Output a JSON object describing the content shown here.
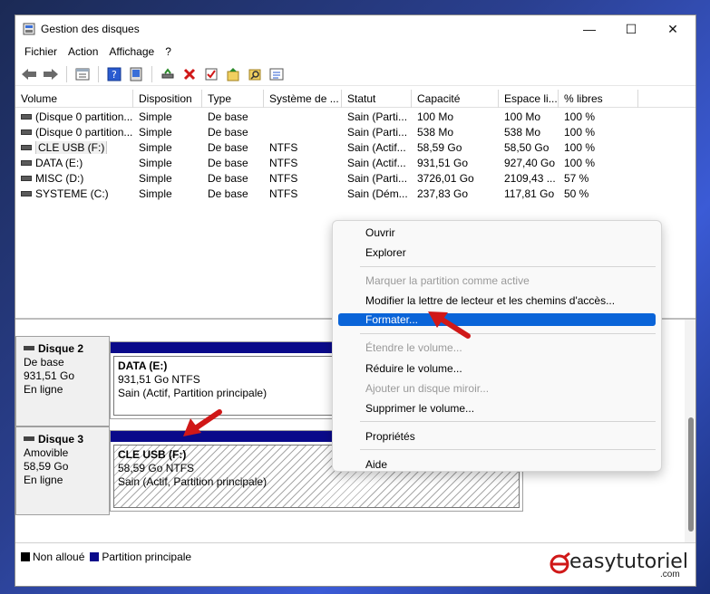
{
  "window": {
    "title": "Gestion des disques",
    "controls": {
      "minimize": "—",
      "maximize": "☐",
      "close": "✕"
    }
  },
  "menu": [
    "Fichier",
    "Action",
    "Affichage",
    "?"
  ],
  "toolbar": {
    "icons": [
      "back-icon",
      "forward-icon",
      "properties-icon",
      "help-icon",
      "help-book-icon",
      "connect-icon",
      "delete-icon",
      "check-icon",
      "new-icon",
      "search-icon",
      "list-icon"
    ]
  },
  "volume_list": {
    "columns": [
      "Volume",
      "Disposition",
      "Type",
      "Système de ...",
      "Statut",
      "Capacité",
      "Espace li...",
      "% libres"
    ],
    "rows": [
      [
        "(Disque 0 partition...",
        "Simple",
        "De base",
        "",
        "Sain (Parti...",
        "100 Mo",
        "100 Mo",
        "100 %"
      ],
      [
        "(Disque 0 partition...",
        "Simple",
        "De base",
        "",
        "Sain (Parti...",
        "538 Mo",
        "538 Mo",
        "100 %"
      ],
      [
        "CLE USB (F:)",
        "Simple",
        "De base",
        "NTFS",
        "Sain (Actif...",
        "58,59 Go",
        "58,50 Go",
        "100 %"
      ],
      [
        "DATA (E:)",
        "Simple",
        "De base",
        "NTFS",
        "Sain (Actif...",
        "931,51 Go",
        "927,40 Go",
        "100 %"
      ],
      [
        "MISC (D:)",
        "Simple",
        "De base",
        "NTFS",
        "Sain (Parti...",
        "3726,01 Go",
        "2109,43 ...",
        "57 %"
      ],
      [
        "SYSTEME (C:)",
        "Simple",
        "De base",
        "NTFS",
        "Sain (Dém...",
        "237,83 Go",
        "117,81 Go",
        "50 %"
      ]
    ]
  },
  "disks": [
    {
      "name": "Disque 2",
      "type": "De base",
      "size": "931,51 Go",
      "status": "En ligne",
      "partition": {
        "name": "DATA  (E:)",
        "size": "931,51 Go NTFS",
        "status": "Sain (Actif, Partition principale)"
      }
    },
    {
      "name": "Disque 3",
      "type": "Amovible",
      "size": "58,59 Go",
      "status": "En ligne",
      "partition": {
        "name": "CLE USB  (F:)",
        "size": "58,59 Go NTFS",
        "status": "Sain (Actif, Partition principale)"
      }
    }
  ],
  "legend": {
    "unallocated": "Non alloué",
    "primary": "Partition principale"
  },
  "context_menu": {
    "items": [
      {
        "label": "Ouvrir",
        "disabled": false
      },
      {
        "label": "Explorer",
        "disabled": false
      },
      {
        "label": "Marquer la partition comme active",
        "disabled": true
      },
      {
        "label": "Modifier la lettre de lecteur et les chemins d'accès...",
        "disabled": false
      },
      {
        "label": "Formater...",
        "disabled": false,
        "highlighted": true
      },
      {
        "label": "Étendre le volume...",
        "disabled": true
      },
      {
        "label": "Réduire le volume...",
        "disabled": false
      },
      {
        "label": "Ajouter un disque miroir...",
        "disabled": true
      },
      {
        "label": "Supprimer le volume...",
        "disabled": false
      },
      {
        "label": "Propriétés",
        "disabled": false
      },
      {
        "label": "Aide",
        "disabled": false
      }
    ]
  },
  "brand": {
    "name": "easytutoriel",
    "tld": ".com"
  },
  "colors": {
    "primary_partition": "#0a0a8a",
    "unallocated": "#000000",
    "highlight": "#0a64d8",
    "arrow": "#d01818"
  }
}
